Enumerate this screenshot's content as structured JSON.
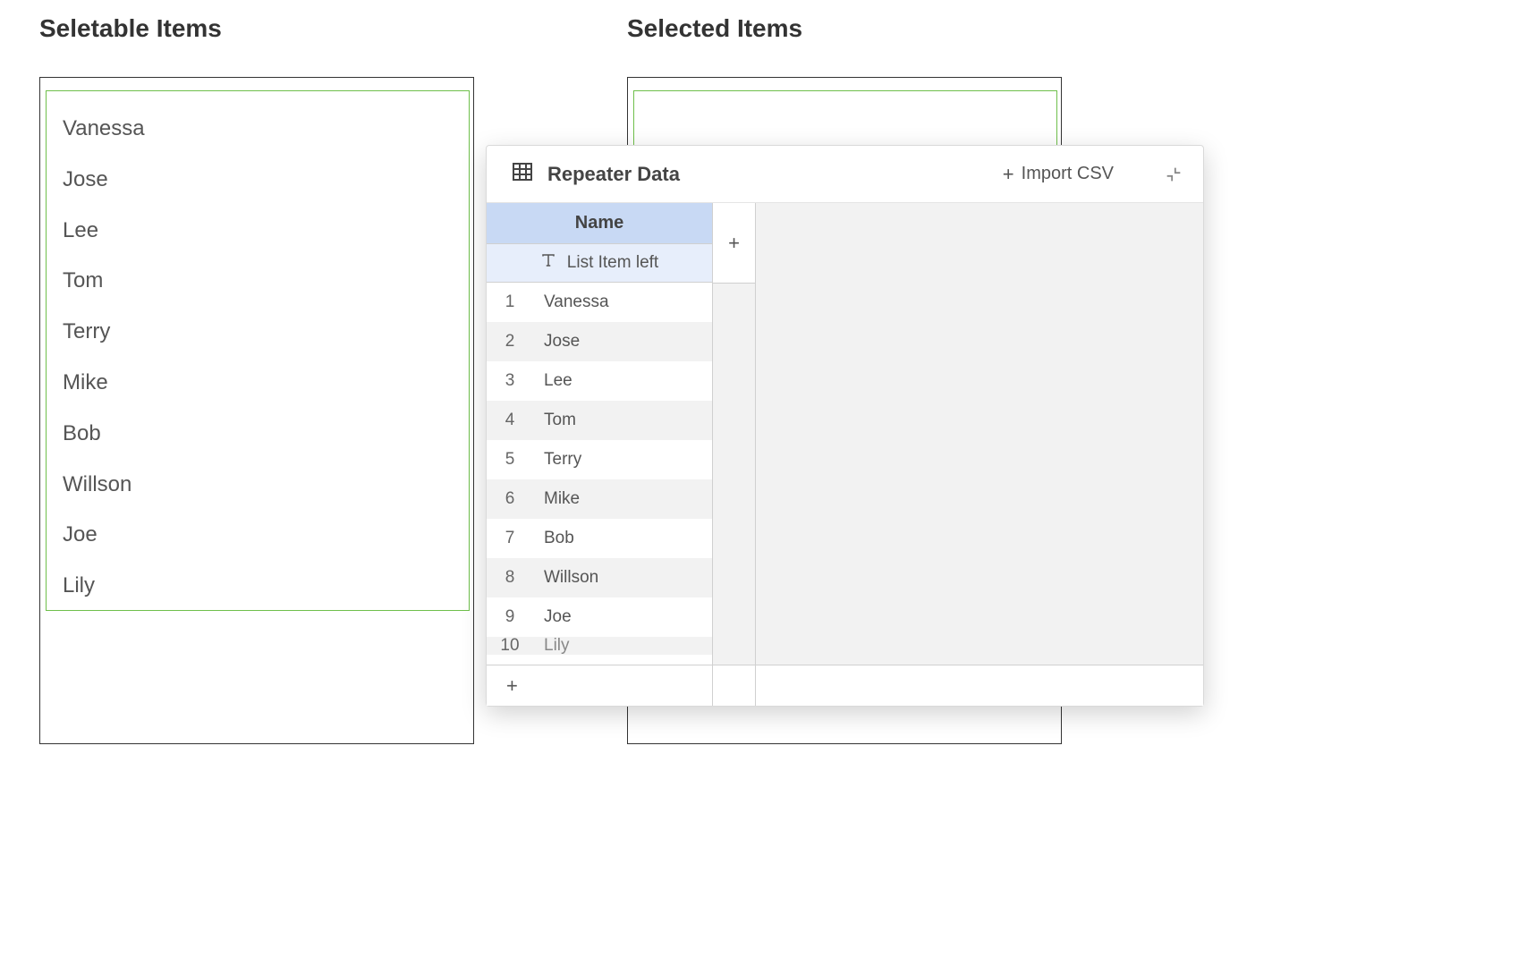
{
  "headings": {
    "left": "Seletable Items",
    "right": "Selected Items"
  },
  "selectable_items": [
    "Vanessa",
    "Jose",
    "Lee",
    "Tom",
    "Terry",
    "Mike",
    "Bob",
    "Willson",
    "Joe",
    "Lily"
  ],
  "repeater": {
    "title": "Repeater Data",
    "import_label": "Import CSV",
    "column_header": "Name",
    "column_type_label": "List Item left",
    "rows": [
      {
        "index": 1,
        "value": "Vanessa"
      },
      {
        "index": 2,
        "value": "Jose"
      },
      {
        "index": 3,
        "value": "Lee"
      },
      {
        "index": 4,
        "value": "Tom"
      },
      {
        "index": 5,
        "value": "Terry"
      },
      {
        "index": 6,
        "value": "Mike"
      },
      {
        "index": 7,
        "value": "Bob"
      },
      {
        "index": 8,
        "value": "Willson"
      },
      {
        "index": 9,
        "value": "Joe"
      },
      {
        "index": 10,
        "value": "Lily"
      }
    ]
  }
}
